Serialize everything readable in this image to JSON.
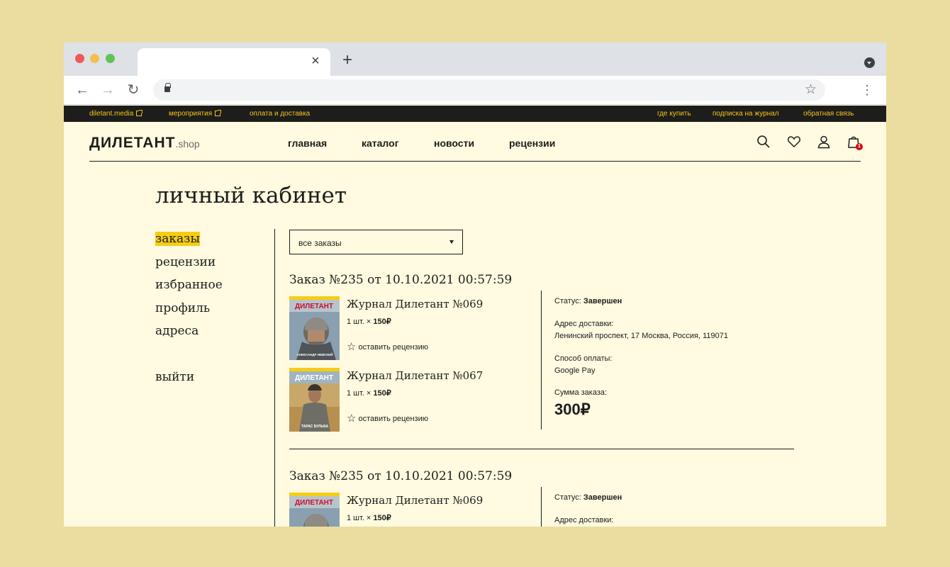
{
  "browser": {
    "tab_close": "×",
    "new_tab": "+",
    "nav_back": "←",
    "nav_forward": "→",
    "nav_reload": "↻",
    "bookmark_star": "☆",
    "menu": "⋮"
  },
  "topbar": {
    "left_links": [
      "diletant.media",
      "мероприятия",
      "оплата и доставка"
    ],
    "right_links": [
      "где купить",
      "подписка на журнал",
      "обратная связь"
    ],
    "color": "#f5c518"
  },
  "header": {
    "logo_main": "ДИЛЕТАНТ",
    "logo_sub": ".shop",
    "nav": [
      "главная",
      "каталог",
      "новости",
      "рецензии"
    ],
    "cart_count": "1",
    "icons": [
      "search-icon",
      "heart-icon",
      "user-icon",
      "cart-icon"
    ]
  },
  "page": {
    "title": "личный кабинет"
  },
  "sidebar": {
    "items": [
      "заказы",
      "рецензии",
      "избранное",
      "профиль",
      "адреса"
    ],
    "active": "заказы",
    "logout": "выйти",
    "highlight_color": "#f5cd16"
  },
  "filter": {
    "selected": "все заказы"
  },
  "orders": [
    {
      "title": "Заказ №235 от 10.10.2021 00:57:59",
      "items": [
        {
          "name": "Журнал Дилетант №069",
          "qty": "1 шт. ×",
          "price": "150₽",
          "review": "оставить рецензию",
          "cover_masthead": "ДИЛЕТАНТ",
          "cover_caption": "АЛЕКСАНДР НЕВСКИЙ"
        },
        {
          "name": "Журнал Дилетант №067",
          "qty": "1 шт. ×",
          "price": "150₽",
          "review": "оставить рецензию",
          "cover_masthead": "ДИЛЕТАНТ",
          "cover_caption": "ТАРАС БУЛЬБА"
        }
      ],
      "status_label": "Статус:",
      "status_value": "Завершен",
      "address_label": "Адрес доставки:",
      "address_value": "Ленинский проспект, 17 Москва, Россия, 119071",
      "payment_label": "Способ оплаты:",
      "payment_value": "Google Pay",
      "total_label": "Сумма заказа:",
      "total_value": "300₽"
    },
    {
      "title": "Заказ №235 от 10.10.2021 00:57:59",
      "items": [
        {
          "name": "Журнал Дилетант №069",
          "qty": "1 шт. ×",
          "price": "150₽",
          "cover_masthead": "ДИЛЕТАНТ"
        }
      ],
      "status_label": "Статус:",
      "status_value": "Завершен",
      "address_label": "Адрес доставки:"
    }
  ]
}
